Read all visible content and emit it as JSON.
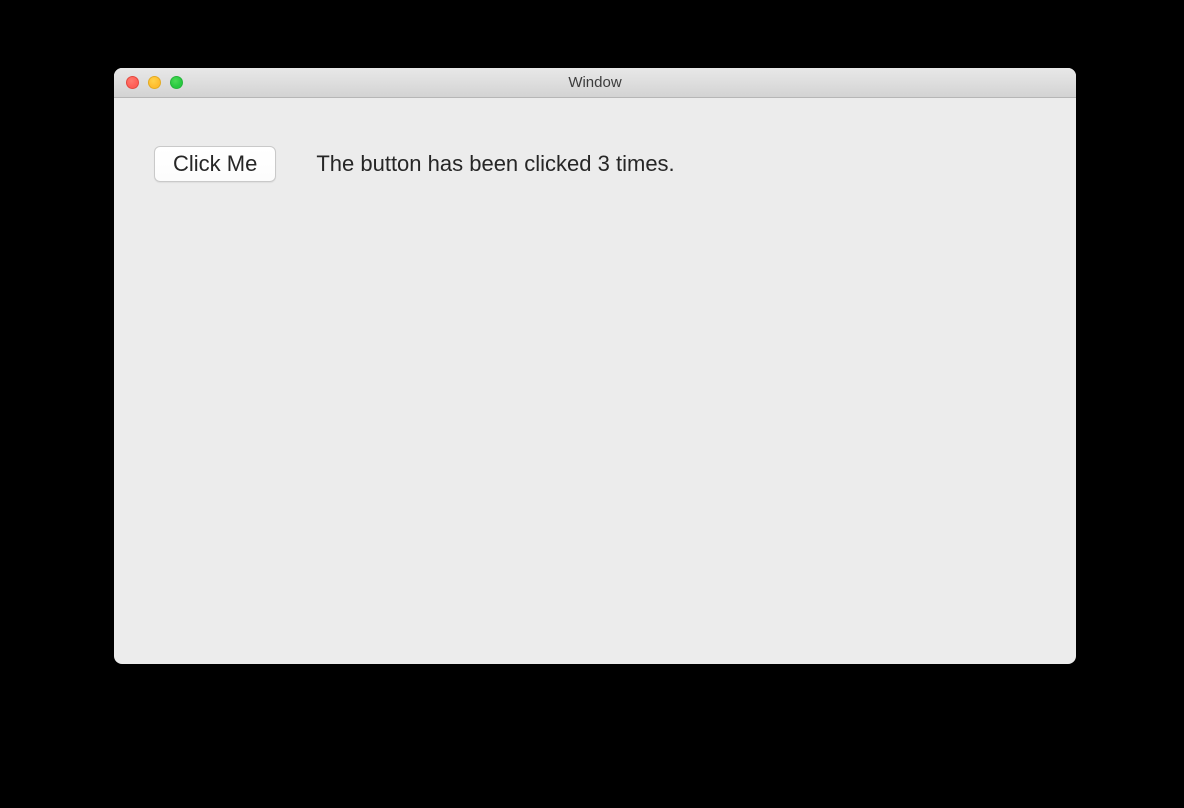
{
  "window": {
    "title": "Window"
  },
  "content": {
    "button_label": "Click Me",
    "status_text": "The button has been clicked 3 times."
  }
}
